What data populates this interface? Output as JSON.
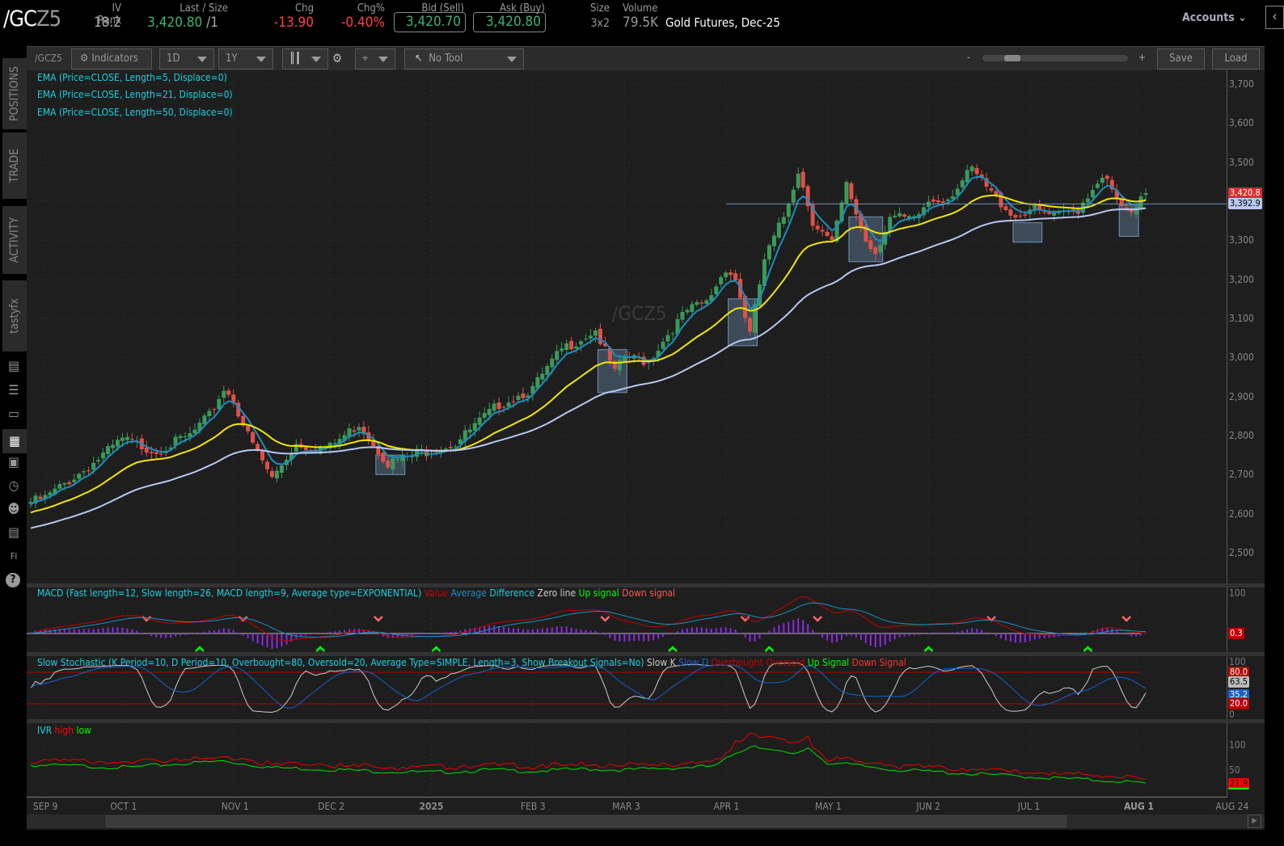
{
  "header": {
    "symbol_main": "/GC",
    "symbol_suffix": "Z5",
    "iv_rank_label": "IV Rank",
    "iv_rank": "18.2",
    "last_label": "Last / Size",
    "last": "3,420.80",
    "last_size": "/1",
    "chg_label": "Chg",
    "chg": "-13.90",
    "chgpct_label": "Chg%",
    "chgpct": "-0.40%",
    "bid_label": "Bid (Sell)",
    "bid": "3,420.70",
    "ask_label": "Ask (Buy)",
    "ask": "3,420.80",
    "size_label": "Size",
    "size": "3x2",
    "volume_label": "Volume",
    "volume": "79.5K",
    "description": "Gold Futures, Dec-25",
    "accounts": "Accounts"
  },
  "sidebar": {
    "tabs": [
      "POSITIONS",
      "TRADE",
      "ACTIVITY",
      "tastyfx"
    ],
    "icons": [
      "news-icon",
      "watchlist-icon",
      "tv-icon",
      "chart-icon",
      "grid-icon",
      "history-icon",
      "community-icon",
      "calendar-icon",
      "fi-icon",
      "help-icon"
    ]
  },
  "toolbar": {
    "symbol": "/GCZ5",
    "indicators": "Indicators",
    "interval": "1D",
    "range": "1Y",
    "tool": "No Tool",
    "zoom_minus": "-",
    "zoom_plus": "+",
    "zoom_level": 0.2,
    "save": "Save",
    "load": "Load"
  },
  "studies": {
    "ema5": "EMA (Price=CLOSE, Length=5, Displace=0)",
    "ema21": "EMA (Price=CLOSE, Length=21, Displace=0)",
    "ema50": "EMA (Price=CLOSE, Length=50, Displace=0)",
    "macd": "MACD (Fast length=12, Slow length=26, MACD length=9, Average type=EXPONENTIAL)",
    "macd_legend": [
      "Value",
      "Average",
      "Difference",
      "Zero line",
      "Up signal",
      "Down signal"
    ],
    "stoch": "Slow Stochastic (K Period=10, D Period=10, Overbought=80, Oversold=20, Average Type=SIMPLE, Length=3, Show Breakout Signals=No)",
    "stoch_legend": [
      "Slow K",
      "Slow D",
      "Overbought",
      "Oversold",
      "Up Signal",
      "Down Signal"
    ],
    "ivr": "IVR",
    "ivr_legend": [
      "high",
      "low"
    ]
  },
  "watermark": "/GCZ5",
  "colors": {
    "up": "#3a9a5a",
    "down": "#e0504a",
    "ema5": "#1a8fc0",
    "ema21": "#f2e600",
    "ema50": "#b8c8f0",
    "label": "#19d1e0"
  },
  "chart_data": {
    "type": "candlestick",
    "price_axis": {
      "ticks": [
        "3,700",
        "3,600",
        "3,500",
        "3,400",
        "3,300",
        "3,200",
        "3,100",
        "3,000",
        "2,900",
        "2,800",
        "2,700",
        "2,600",
        "2,500"
      ],
      "range": [
        2500,
        3700
      ]
    },
    "x_ticks": [
      {
        "label": "SEP 9",
        "day": 3
      },
      {
        "label": "OCT 1",
        "day": 19
      },
      {
        "label": "NOV 1",
        "day": 42
      },
      {
        "label": "DEC 2",
        "day": 62
      },
      {
        "label": "2025",
        "day": 83
      },
      {
        "label": "FEB 3",
        "day": 104
      },
      {
        "label": "MAR 3",
        "day": 123
      },
      {
        "label": "APR 1",
        "day": 144
      },
      {
        "label": "MAY 1",
        "day": 165
      },
      {
        "label": "JUN 2",
        "day": 186
      },
      {
        "label": "JUL 1",
        "day": 207
      },
      {
        "label": "AUG 1",
        "day": 229
      },
      {
        "label": "AUG 24",
        "day": 248
      }
    ],
    "close_anchors": [
      [
        0,
        2630
      ],
      [
        3,
        2640
      ],
      [
        12,
        2720
      ],
      [
        19,
        2790
      ],
      [
        26,
        2760
      ],
      [
        33,
        2800
      ],
      [
        37,
        2850
      ],
      [
        40,
        2920
      ],
      [
        42,
        2890
      ],
      [
        45,
        2800
      ],
      [
        50,
        2690
      ],
      [
        55,
        2780
      ],
      [
        58,
        2770
      ],
      [
        62,
        2770
      ],
      [
        68,
        2830
      ],
      [
        74,
        2730
      ],
      [
        82,
        2760
      ],
      [
        88,
        2780
      ],
      [
        97,
        2880
      ],
      [
        104,
        2920
      ],
      [
        110,
        3020
      ],
      [
        117,
        3070
      ],
      [
        121,
        2960
      ],
      [
        123,
        3000
      ],
      [
        128,
        2990
      ],
      [
        132,
        3060
      ],
      [
        136,
        3120
      ],
      [
        140,
        3140
      ],
      [
        144,
        3230
      ],
      [
        146,
        3200
      ],
      [
        149,
        3060
      ],
      [
        152,
        3250
      ],
      [
        156,
        3360
      ],
      [
        159,
        3480
      ],
      [
        162,
        3350
      ],
      [
        164,
        3320
      ],
      [
        166,
        3290
      ],
      [
        169,
        3440
      ],
      [
        173,
        3300
      ],
      [
        175,
        3270
      ],
      [
        178,
        3360
      ],
      [
        183,
        3350
      ],
      [
        186,
        3400
      ],
      [
        190,
        3410
      ],
      [
        195,
        3480
      ],
      [
        199,
        3420
      ],
      [
        204,
        3360
      ],
      [
        207,
        3380
      ],
      [
        212,
        3360
      ],
      [
        217,
        3380
      ],
      [
        222,
        3470
      ],
      [
        225,
        3400
      ],
      [
        228,
        3360
      ],
      [
        231,
        3420.8
      ]
    ],
    "highlights": [
      [
        72,
        77,
        2700,
        2750
      ],
      [
        118,
        123,
        2910,
        3020
      ],
      [
        145,
        150,
        3030,
        3150
      ],
      [
        170,
        176,
        3245,
        3360
      ],
      [
        204,
        209,
        3295,
        3345
      ],
      [
        226,
        229,
        3310,
        3390
      ]
    ],
    "support_line": 3392.9,
    "last_price_tag": "3,420.8",
    "support_tag": "3,392.9",
    "macd": {
      "axis": [
        "100"
      ],
      "last_tag": "0.3"
    },
    "stoch": {
      "axis": [
        "100",
        "0"
      ],
      "tags": [
        "80.0",
        "63.5",
        "35.2",
        "20.0"
      ],
      "overbought": 80,
      "oversold": 20
    },
    "ivr": {
      "axis": [
        "100",
        "50"
      ],
      "last_tag": "21.9",
      "low_anchors": [
        [
          0,
          60
        ],
        [
          10,
          58
        ],
        [
          20,
          55
        ],
        [
          30,
          62
        ],
        [
          40,
          68
        ],
        [
          50,
          55
        ],
        [
          60,
          52
        ],
        [
          70,
          48
        ],
        [
          83,
          45
        ],
        [
          95,
          50
        ],
        [
          104,
          48
        ],
        [
          115,
          52
        ],
        [
          123,
          50
        ],
        [
          135,
          55
        ],
        [
          142,
          58
        ],
        [
          146,
          85
        ],
        [
          150,
          100
        ],
        [
          154,
          88
        ],
        [
          158,
          80
        ],
        [
          161,
          95
        ],
        [
          165,
          65
        ],
        [
          172,
          58
        ],
        [
          180,
          50
        ],
        [
          190,
          45
        ],
        [
          200,
          40
        ],
        [
          210,
          35
        ],
        [
          220,
          30
        ],
        [
          226,
          28
        ],
        [
          231,
          22
        ]
      ]
    }
  }
}
